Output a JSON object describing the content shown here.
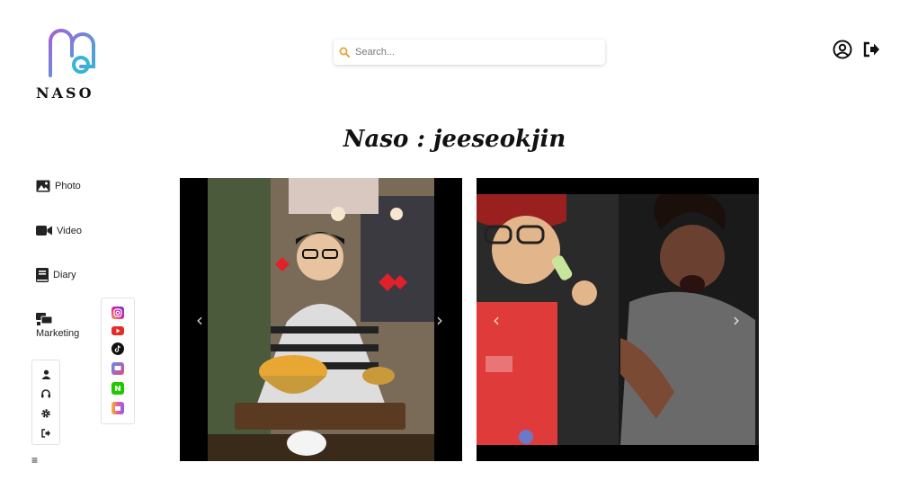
{
  "brand": {
    "logo_text": "NASO"
  },
  "search": {
    "placeholder": "Search..."
  },
  "header": {
    "profile_icon": "user-circle-icon",
    "logout_icon": "sign-out-icon"
  },
  "page": {
    "title": "Naso : jeeseokjin"
  },
  "sidebar": {
    "items": [
      {
        "label": "Photo",
        "icon": "image-icon"
      },
      {
        "label": "Video",
        "icon": "video-camera-icon"
      },
      {
        "label": "Diary",
        "icon": "book-icon"
      },
      {
        "label": "Marketing",
        "icon": "marketing-icon"
      }
    ],
    "social": [
      "instagram-icon",
      "youtube-icon",
      "tiktok-icon",
      "chat-icon",
      "naver-icon",
      "shop-icon"
    ],
    "utilities": [
      "user-icon",
      "headset-icon",
      "gear-icon",
      "sign-out-icon"
    ],
    "menu_icon": "≡"
  },
  "carousels": [
    {
      "prev": "‹",
      "next": "›"
    },
    {
      "prev": "‹",
      "next": "›"
    }
  ],
  "colors": {
    "accent": "#e8a33c",
    "brand_purple": "#8a5ad8",
    "brand_cyan": "#36b6d6"
  }
}
